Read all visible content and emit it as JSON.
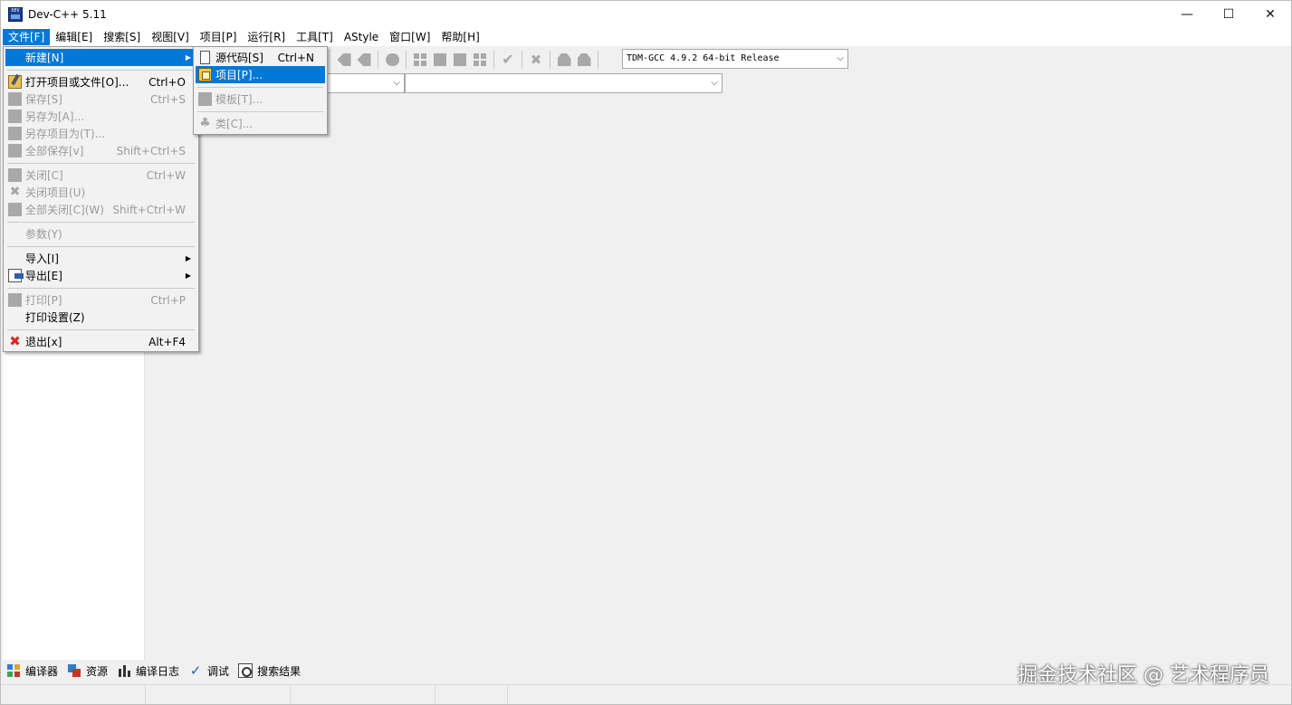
{
  "window": {
    "title": "Dev-C++ 5.11",
    "controls": {
      "minimize": "—",
      "maximize": "☐",
      "close": "✕"
    }
  },
  "menubar": {
    "items": [
      {
        "label": "文件[F]",
        "active": true
      },
      {
        "label": "编辑[E]"
      },
      {
        "label": "搜索[S]"
      },
      {
        "label": "视图[V]"
      },
      {
        "label": "项目[P]"
      },
      {
        "label": "运行[R]"
      },
      {
        "label": "工具[T]"
      },
      {
        "label": "AStyle"
      },
      {
        "label": "窗口[W]"
      },
      {
        "label": "帮助[H]"
      }
    ]
  },
  "toolbar": {
    "compiler_select": {
      "value": "TDM-GCC 4.9.2 64-bit Release"
    },
    "class_select": {
      "value": ""
    },
    "member_select": {
      "value": ""
    }
  },
  "file_menu": {
    "items": {
      "new": {
        "label": "新建[N]",
        "arrow": "▶"
      },
      "open": {
        "label": "打开项目或文件[O]...",
        "shortcut": "Ctrl+O"
      },
      "save": {
        "label": "保存[S]",
        "shortcut": "Ctrl+S"
      },
      "save_as": {
        "label": "另存为[A]..."
      },
      "save_project_as": {
        "label": "另存项目为(T)..."
      },
      "save_all": {
        "label": "全部保存[v]",
        "shortcut": "Shift+Ctrl+S"
      },
      "close": {
        "label": "关闭[C]",
        "shortcut": "Ctrl+W"
      },
      "close_project": {
        "label": "关闭项目(U)"
      },
      "close_all": {
        "label": "全部关闭[C](W)",
        "shortcut": "Shift+Ctrl+W"
      },
      "properties": {
        "label": "参数(Y)"
      },
      "import": {
        "label": "导入[I]",
        "arrow": "▶"
      },
      "export": {
        "label": "导出[E]",
        "arrow": "▶"
      },
      "print": {
        "label": "打印[P]",
        "shortcut": "Ctrl+P"
      },
      "print_setup": {
        "label": "打印设置(Z)"
      },
      "exit": {
        "label": "退出[x]",
        "shortcut": "Alt+F4"
      }
    }
  },
  "new_submenu": {
    "source": {
      "label": "源代码[S]",
      "shortcut": "Ctrl+N"
    },
    "project": {
      "label": "项目[P]..."
    },
    "template": {
      "label": "模板[T]..."
    },
    "class": {
      "label": "类[C]..."
    }
  },
  "bottom_tabs": [
    {
      "label": "编译器",
      "icon": "compiler-icon"
    },
    {
      "label": "资源",
      "icon": "resources-icon"
    },
    {
      "label": "编译日志",
      "icon": "compile-log-icon"
    },
    {
      "label": "调试",
      "icon": "debug-icon"
    },
    {
      "label": "搜索结果",
      "icon": "find-results-icon"
    }
  ],
  "watermark": "掘金技术社区 @ 艺术程序员",
  "colors": {
    "highlight": "#0078d7",
    "menu_bg": "#f2f2f2",
    "disabled": "#9a9a9a",
    "exit_icon": "#d12b2b"
  }
}
